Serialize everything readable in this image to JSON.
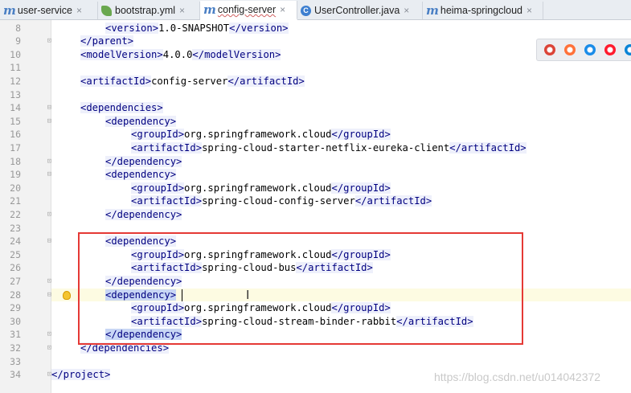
{
  "tabs": [
    {
      "name": "user-service",
      "icon": "maven-m-icon",
      "close": "×",
      "active": false
    },
    {
      "name": "bootstrap.yml",
      "icon": "spring-leaf-icon",
      "close": "×",
      "active": false
    },
    {
      "name": "config-server",
      "icon": "maven-m-icon",
      "close": "×",
      "active": true
    },
    {
      "name": "UserController.java",
      "icon": "class-c-icon",
      "close": "×",
      "active": false
    },
    {
      "name": "heima-springcloud",
      "icon": "maven-m-icon",
      "close": "×",
      "active": false
    }
  ],
  "lines": [
    {
      "n": "8",
      "indent": 2,
      "parts": [
        {
          "t": "<",
          "k": "tag"
        },
        {
          "t": "version",
          "k": "tag"
        },
        {
          "t": ">",
          "k": "tag"
        },
        {
          "t": "1.0-SNAPSHOT",
          "k": "text"
        },
        {
          "t": "</version>",
          "k": "tag"
        }
      ]
    },
    {
      "n": "9",
      "indent": 1,
      "parts": [
        {
          "t": "</parent>",
          "k": "tag"
        }
      ]
    },
    {
      "n": "10",
      "indent": 1,
      "parts": [
        {
          "t": "<modelVersion>",
          "k": "tag"
        },
        {
          "t": "4.0.0",
          "k": "text"
        },
        {
          "t": "</modelVersion>",
          "k": "tag"
        }
      ]
    },
    {
      "n": "11",
      "indent": 0,
      "parts": []
    },
    {
      "n": "12",
      "indent": 1,
      "parts": [
        {
          "t": "<artifactId>",
          "k": "tag"
        },
        {
          "t": "config-server",
          "k": "text"
        },
        {
          "t": "</artifactId>",
          "k": "tag"
        }
      ]
    },
    {
      "n": "13",
      "indent": 0,
      "parts": []
    },
    {
      "n": "14",
      "indent": 1,
      "parts": [
        {
          "t": "<dependencies>",
          "k": "tag"
        }
      ]
    },
    {
      "n": "15",
      "indent": 2,
      "parts": [
        {
          "t": "<dependency>",
          "k": "tag"
        }
      ]
    },
    {
      "n": "16",
      "indent": 3,
      "parts": [
        {
          "t": "<groupId>",
          "k": "tag"
        },
        {
          "t": "org.springframework.cloud",
          "k": "text"
        },
        {
          "t": "</groupId>",
          "k": "tag"
        }
      ]
    },
    {
      "n": "17",
      "indent": 3,
      "parts": [
        {
          "t": "<artifactId>",
          "k": "tag"
        },
        {
          "t": "spring-cloud-starter-netflix-eureka-client",
          "k": "text"
        },
        {
          "t": "</artifactId>",
          "k": "tag"
        }
      ]
    },
    {
      "n": "18",
      "indent": 2,
      "parts": [
        {
          "t": "</dependency>",
          "k": "tag"
        }
      ]
    },
    {
      "n": "19",
      "indent": 2,
      "parts": [
        {
          "t": "<dependency>",
          "k": "tag"
        }
      ]
    },
    {
      "n": "20",
      "indent": 3,
      "parts": [
        {
          "t": "<groupId>",
          "k": "tag"
        },
        {
          "t": "org.springframework.cloud",
          "k": "text"
        },
        {
          "t": "</groupId>",
          "k": "tag"
        }
      ]
    },
    {
      "n": "21",
      "indent": 3,
      "parts": [
        {
          "t": "<artifactId>",
          "k": "tag"
        },
        {
          "t": "spring-cloud-config-server",
          "k": "text"
        },
        {
          "t": "</artifactId>",
          "k": "tag"
        }
      ]
    },
    {
      "n": "22",
      "indent": 2,
      "parts": [
        {
          "t": "</dependency>",
          "k": "tag"
        }
      ]
    },
    {
      "n": "23",
      "indent": 0,
      "parts": []
    },
    {
      "n": "24",
      "indent": 2,
      "parts": [
        {
          "t": "<dependency>",
          "k": "tag"
        }
      ]
    },
    {
      "n": "25",
      "indent": 3,
      "parts": [
        {
          "t": "<groupId>",
          "k": "tag"
        },
        {
          "t": "org.springframework.cloud",
          "k": "text"
        },
        {
          "t": "</groupId>",
          "k": "tag"
        }
      ]
    },
    {
      "n": "26",
      "indent": 3,
      "parts": [
        {
          "t": "<artifactId>",
          "k": "tag"
        },
        {
          "t": "spring-cloud-bus",
          "k": "text"
        },
        {
          "t": "</artifactId>",
          "k": "tag"
        }
      ]
    },
    {
      "n": "27",
      "indent": 2,
      "parts": [
        {
          "t": "</dependency>",
          "k": "tag"
        }
      ]
    },
    {
      "n": "28",
      "indent": 2,
      "current": true,
      "parts": [
        {
          "t": "<dependency>",
          "k": "taghl"
        }
      ]
    },
    {
      "n": "29",
      "indent": 3,
      "parts": [
        {
          "t": "<groupId>",
          "k": "tag"
        },
        {
          "t": "org.springframework.cloud",
          "k": "text"
        },
        {
          "t": "</groupId>",
          "k": "tag"
        }
      ]
    },
    {
      "n": "30",
      "indent": 3,
      "parts": [
        {
          "t": "<artifactId>",
          "k": "tag"
        },
        {
          "t": "spring-cloud-stream-binder-rabbit",
          "k": "text"
        },
        {
          "t": "</artifactId>",
          "k": "tag"
        }
      ]
    },
    {
      "n": "31",
      "indent": 2,
      "parts": [
        {
          "t": "</dependency>",
          "k": "taghl"
        }
      ]
    },
    {
      "n": "32",
      "indent": 1,
      "parts": [
        {
          "t": "</dependencies>",
          "k": "tag"
        }
      ]
    },
    {
      "n": "33",
      "indent": 0,
      "parts": []
    },
    {
      "n": "34",
      "indent": 0,
      "parts": [
        {
          "t": "</project>",
          "k": "tag"
        }
      ]
    }
  ],
  "browser_icons": [
    {
      "name": "chrome-icon",
      "color": "#db4437"
    },
    {
      "name": "firefox-icon",
      "color": "#ff7139"
    },
    {
      "name": "safari-icon",
      "color": "#1a8ce8"
    },
    {
      "name": "opera-icon",
      "color": "#ff1b2d"
    },
    {
      "name": "edge-icon",
      "color": "#0a84d6"
    }
  ],
  "watermark": "https://blog.csdn.net/u014042372"
}
